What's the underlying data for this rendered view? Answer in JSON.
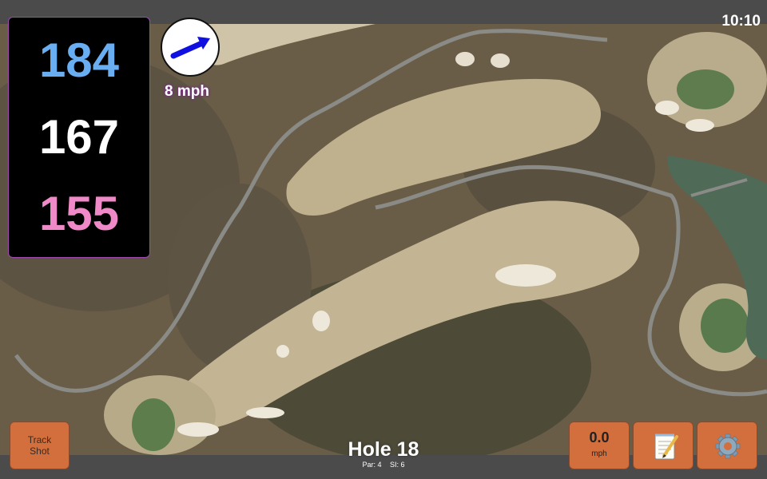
{
  "status": {
    "time": "10:10"
  },
  "distances": {
    "back": "184",
    "center": "167",
    "front": "155",
    "back_color": "#6aaef2",
    "center_color": "#ffffff",
    "front_color": "#f089c8"
  },
  "wind": {
    "speed": "8 mph",
    "arrow_color": "#1010e0"
  },
  "hole": {
    "title": "Hole 18",
    "par": "Par: 4",
    "si": "SI: 6"
  },
  "buttons": {
    "track_shot": "Track Shot",
    "speed_value": "0.0",
    "speed_unit": "mph",
    "notes_icon": "notepad-icon",
    "settings_icon": "gear-icon"
  },
  "colors": {
    "button": "#d26f3c",
    "panel_border": "#a04ab0"
  }
}
